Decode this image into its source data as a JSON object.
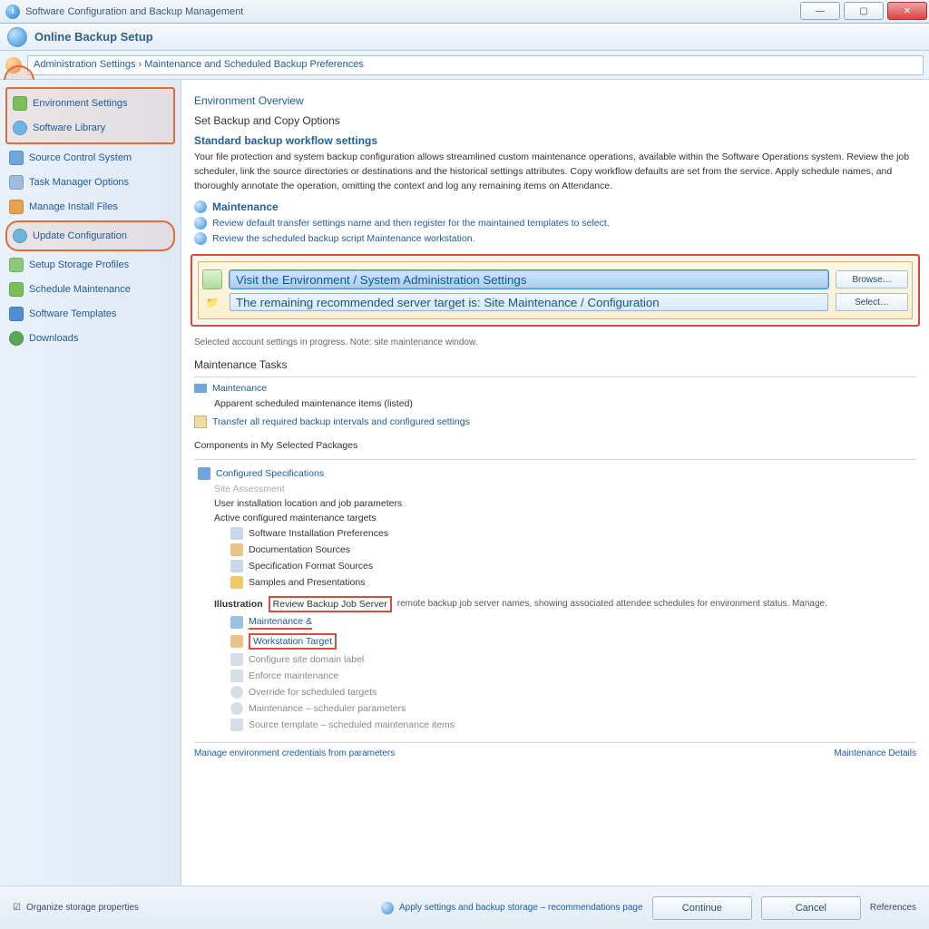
{
  "window": {
    "title": "Software Configuration and Backup Management"
  },
  "toolbar": {
    "title": "Online Backup Setup"
  },
  "breadcrumb": {
    "text": "Administration Settings › Maintenance and Scheduled Backup Preferences"
  },
  "sidebar": {
    "items": [
      {
        "label": "Environment Settings",
        "icon_name": "gear-green-icon",
        "icon_color": "#7bbf5a"
      },
      {
        "label": "Software Library",
        "icon_name": "sphere-icon",
        "icon_color": "#6fb6e8"
      },
      {
        "label": "Source Control System",
        "icon_name": "stack-blue-icon",
        "icon_color": "#6fa4dc"
      },
      {
        "label": "Task Manager Options",
        "icon_name": "tasks-icon",
        "icon_color": "#9dbce0"
      },
      {
        "label": "Manage Install Files",
        "icon_name": "package-orange-icon",
        "icon_color": "#e7a24e"
      },
      {
        "label": "Update Configuration",
        "icon_name": "globe-icon",
        "icon_color": "#6bb5d9"
      },
      {
        "label": "Setup Storage Profiles",
        "icon_name": "folder-green-icon",
        "icon_color": "#8dc97a"
      },
      {
        "label": "Schedule Maintenance",
        "icon_name": "calendar-green-icon",
        "icon_color": "#7bbf5a"
      },
      {
        "label": "Software Templates",
        "icon_name": "users-icon",
        "icon_color": "#4f8fd4"
      },
      {
        "label": "Downloads",
        "icon_name": "world-icon",
        "icon_color": "#58a858"
      }
    ]
  },
  "main": {
    "crumb_small": "Environment Overview",
    "section_title": "Set Backup and Copy Options",
    "sub1": "Standard backup workflow settings",
    "para1": "Your file protection and system backup configuration allows streamlined custom maintenance operations, available within the Software Operations system. Review the job scheduler, link the source directories or destinations and the historical settings attributes. Copy workflow defaults are set from the service. Apply schedule names, and thoroughly annotate the operation, omitting the context and log any remaining items on Attendance.",
    "sub2_icon": "sphere-icon",
    "sub2": "Maintenance",
    "link1": "Review default transfer settings name and then register for the maintained templates to select.",
    "link2": "Review the scheduled backup script Maintenance workstation.",
    "callout": {
      "path_selected": "Visit the Environment / System Administration Settings",
      "path_hint": "The remaining recommended server target is: Site Maintenance / Configuration",
      "btn1": "Browse…",
      "btn2": "Select…",
      "note": "Selected account settings in progress. Note: site maintenance window.",
      "hint_icon": "folder-icon"
    },
    "maint_title": "Maintenance Tasks",
    "maint_link": "Maintenance",
    "maint_l1": "Apparent scheduled maintenance items (listed)",
    "maint_l2": "Transfer all required backup intervals and configured settings",
    "tree_title": "Components in My Selected Packages",
    "tree": [
      {
        "label": "Configured Specifications",
        "icon": "screen-icon",
        "icon_color": "#6fa4dc",
        "indent": 0,
        "link": true
      },
      {
        "label": "Site Assessment",
        "icon": "",
        "icon_color": "",
        "indent": 1,
        "link": false,
        "dim": true
      },
      {
        "label": "User installation location and job parameters",
        "icon": "",
        "icon_color": "",
        "indent": 1,
        "link": false
      },
      {
        "label": "Active configured maintenance targets",
        "icon": "",
        "icon_color": "",
        "indent": 1,
        "link": false
      },
      {
        "label": "Software Installation Preferences",
        "icon": "page-icon",
        "icon_color": "#c7d7e7",
        "indent": 2,
        "link": false
      },
      {
        "label": "Documentation Sources",
        "icon": "doc-icon",
        "icon_color": "#e8c48a",
        "indent": 2,
        "link": false
      },
      {
        "label": "Specification Format Sources",
        "icon": "page-icon",
        "icon_color": "#c7d7e7",
        "indent": 2,
        "link": false
      },
      {
        "label": "Samples and Presentations",
        "icon": "folder-icon",
        "icon_color": "#f0c76a",
        "indent": 2,
        "link": false
      }
    ],
    "mid_note_prefix": "Illustration",
    "mid_note_rest": "remote backup job server names, showing associated attendee schedules for environment status. Manage.",
    "red_box1": "Review Backup Job Server",
    "red_underline": "Maintenance &",
    "red_box2": "Workstation Target",
    "grey_list": [
      {
        "label": "Configure site domain label",
        "icon": "page-grey-icon"
      },
      {
        "label": "Enforce maintenance",
        "icon": "book-grey-icon"
      },
      {
        "label": "Override for scheduled targets",
        "icon": "clock-grey-icon"
      },
      {
        "label": "Maintenance – scheduler parameters",
        "icon": "clock-grey-icon"
      },
      {
        "label": "Source template – scheduled maintenance items",
        "icon": "page-grey-icon"
      }
    ],
    "footer_link_left": "Manage environment credentials from parameters",
    "footer_link_right": "Maintenance Details"
  },
  "bottom": {
    "left_note": "Organize storage properties",
    "mid_note": "Apply settings and backup storage – recommendations page",
    "btn_ok": "Continue",
    "btn_cancel": "Cancel",
    "hint_right": "References"
  }
}
